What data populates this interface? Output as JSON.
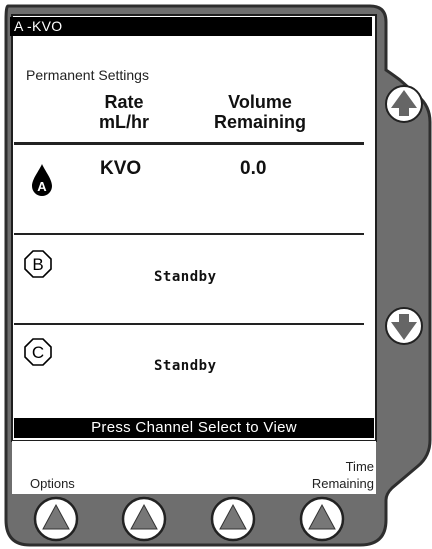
{
  "title_bar": {
    "text": "A -KVO"
  },
  "screen": {
    "section_title": "Permanent Settings",
    "headers": {
      "rate_line1": "Rate",
      "rate_line2": "mL/hr",
      "volume_line1": "Volume",
      "volume_line2": "Remaining"
    },
    "channels": [
      {
        "letter": "A",
        "rate": "KVO",
        "volume": "0.0"
      },
      {
        "letter": "B",
        "status": "Standby"
      },
      {
        "letter": "C",
        "status": "Standby"
      }
    ],
    "status_bar": "Press Channel Select to View"
  },
  "soft_keys": {
    "left_label": "Options",
    "right_label_line1": "Time",
    "right_label_line2": "Remaining"
  },
  "icons": {
    "side_up": "up-arrow-icon",
    "side_down": "down-arrow-icon",
    "soft": "up-triangle-icon",
    "channel_a": "drop-icon",
    "channel_b": "octagon-icon",
    "channel_c": "octagon-icon"
  },
  "colors": {
    "bezel": "#6b6b6b",
    "bezel_dark": "#3a3a3a",
    "screen": "#ffffff",
    "bar": "#000000"
  }
}
